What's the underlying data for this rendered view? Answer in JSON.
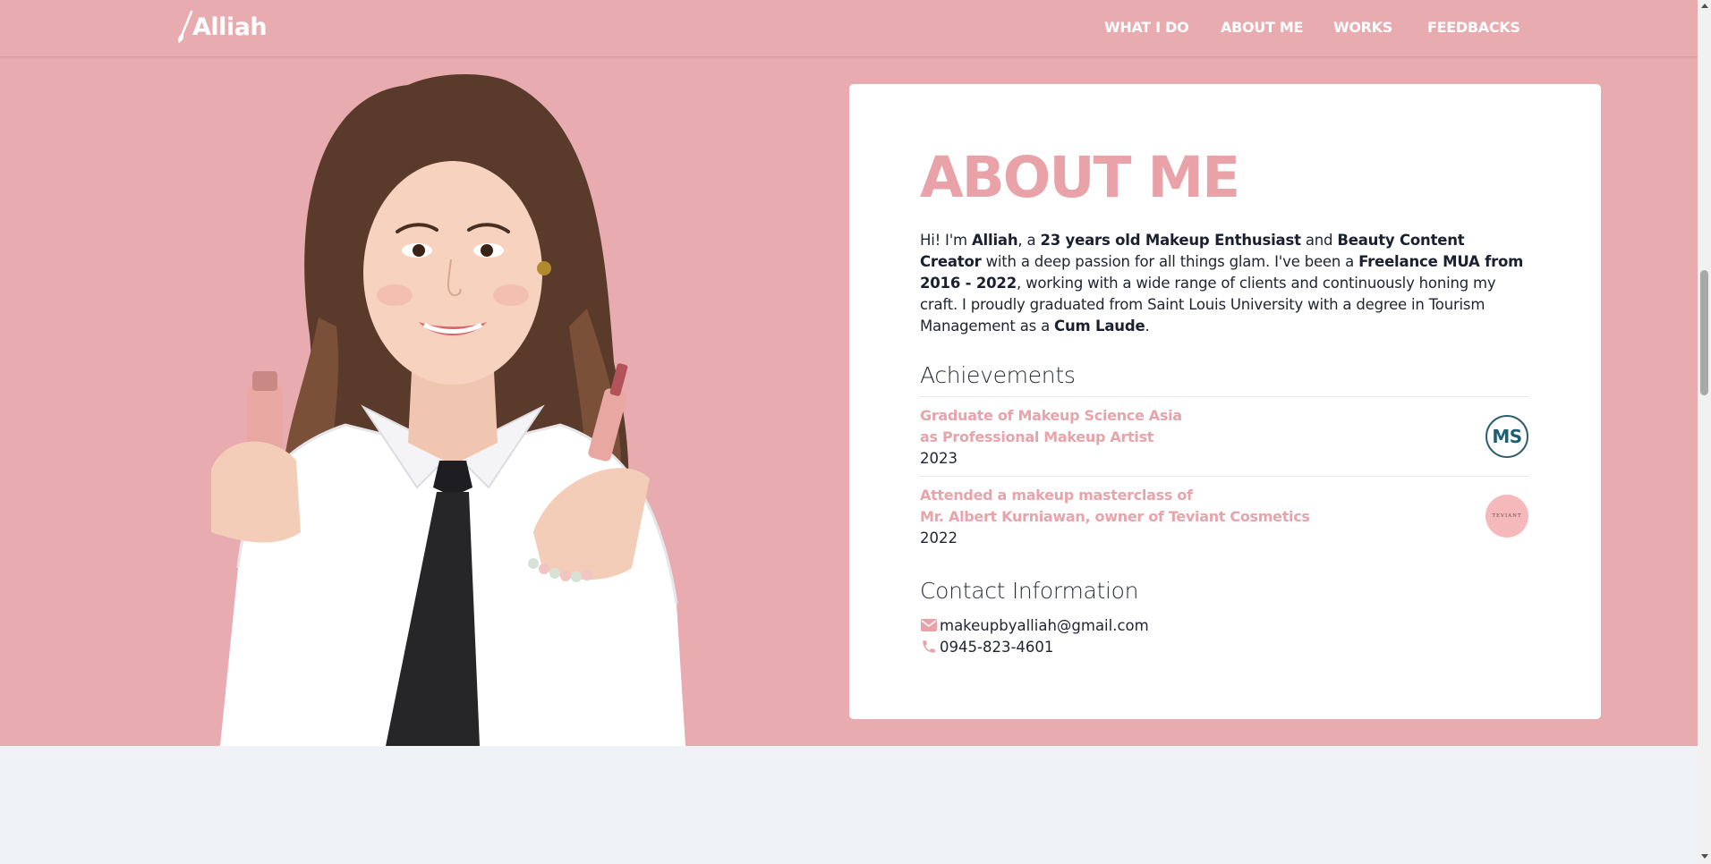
{
  "brand": {
    "logo_text": "Alliah"
  },
  "nav": {
    "items": [
      {
        "label": "WHAT I DO"
      },
      {
        "label": "ABOUT ME"
      },
      {
        "label": "WORKS"
      },
      {
        "label": "FEEDBACKS"
      }
    ]
  },
  "portrait": {
    "icon": "portrait-photo"
  },
  "about": {
    "title": "ABOUT ME",
    "intro": {
      "t1": "Hi! I'm ",
      "name": "Alliah",
      "t2": ", a ",
      "age_role": "23 years old Makeup Enthusiast",
      "t3": " and ",
      "role2": "Beauty Content Creator",
      "t4": " with a deep passion for all things glam. I've been a ",
      "freelance": "Freelance MUA from 2016 - 2022",
      "t5": ", working with a wide range of clients and continuously honing my craft. I proudly graduated from Saint Louis University with a degree in Tourism Management as a ",
      "honor": "Cum Laude",
      "t6": "."
    }
  },
  "achievements": {
    "heading": "Achievements",
    "items": [
      {
        "title_line1": "Graduate of Makeup Science Asia",
        "title_line2": "as Professional Makeup Artist",
        "year": "2023",
        "logo_text": "MS"
      },
      {
        "title_line1": "Attended a makeup masterclass of",
        "title_line2": "Mr. Albert Kurniawan, owner of Teviant Cosmetics",
        "year": "2022",
        "logo_text": "TEVIANT"
      }
    ]
  },
  "contact": {
    "heading": "Contact Information",
    "email": "makeupbyalliah@gmail.com",
    "phone": "0945-823-4601"
  },
  "colors": {
    "hero_bg": "#e8acb0",
    "accent": "#e8a2a8",
    "page_bg": "#eff2f7",
    "text": "#1f2430"
  }
}
